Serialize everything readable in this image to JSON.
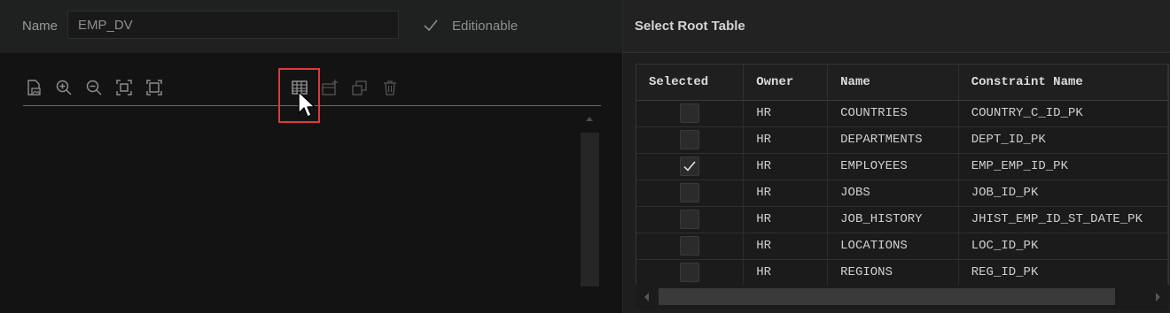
{
  "editor": {
    "name_label": "Name",
    "name_value": "EMP_DV",
    "editionable_label": "Editionable",
    "editionable_checked": true
  },
  "toolbar": {
    "icons": [
      "save-image-icon",
      "zoom-in-icon",
      "zoom-out-icon",
      "fit-screen-icon",
      "actual-size-icon",
      "add-table-icon",
      "add-child-table-icon",
      "duplicate-icon",
      "delete-icon"
    ]
  },
  "root_table": {
    "title": "Select Root Table",
    "columns": [
      "Selected",
      "Owner",
      "Name",
      "Constraint Name"
    ],
    "rows": [
      {
        "selected": false,
        "owner": "HR",
        "name": "COUNTRIES",
        "constraint": "COUNTRY_C_ID_PK"
      },
      {
        "selected": false,
        "owner": "HR",
        "name": "DEPARTMENTS",
        "constraint": "DEPT_ID_PK"
      },
      {
        "selected": true,
        "owner": "HR",
        "name": "EMPLOYEES",
        "constraint": "EMP_EMP_ID_PK"
      },
      {
        "selected": false,
        "owner": "HR",
        "name": "JOBS",
        "constraint": "JOB_ID_PK"
      },
      {
        "selected": false,
        "owner": "HR",
        "name": "JOB_HISTORY",
        "constraint": "JHIST_EMP_ID_ST_DATE_PK"
      },
      {
        "selected": false,
        "owner": "HR",
        "name": "LOCATIONS",
        "constraint": "LOC_ID_PK"
      },
      {
        "selected": false,
        "owner": "HR",
        "name": "REGIONS",
        "constraint": "REG_ID_PK"
      }
    ]
  },
  "colors": {
    "highlight": "#e0393e"
  }
}
